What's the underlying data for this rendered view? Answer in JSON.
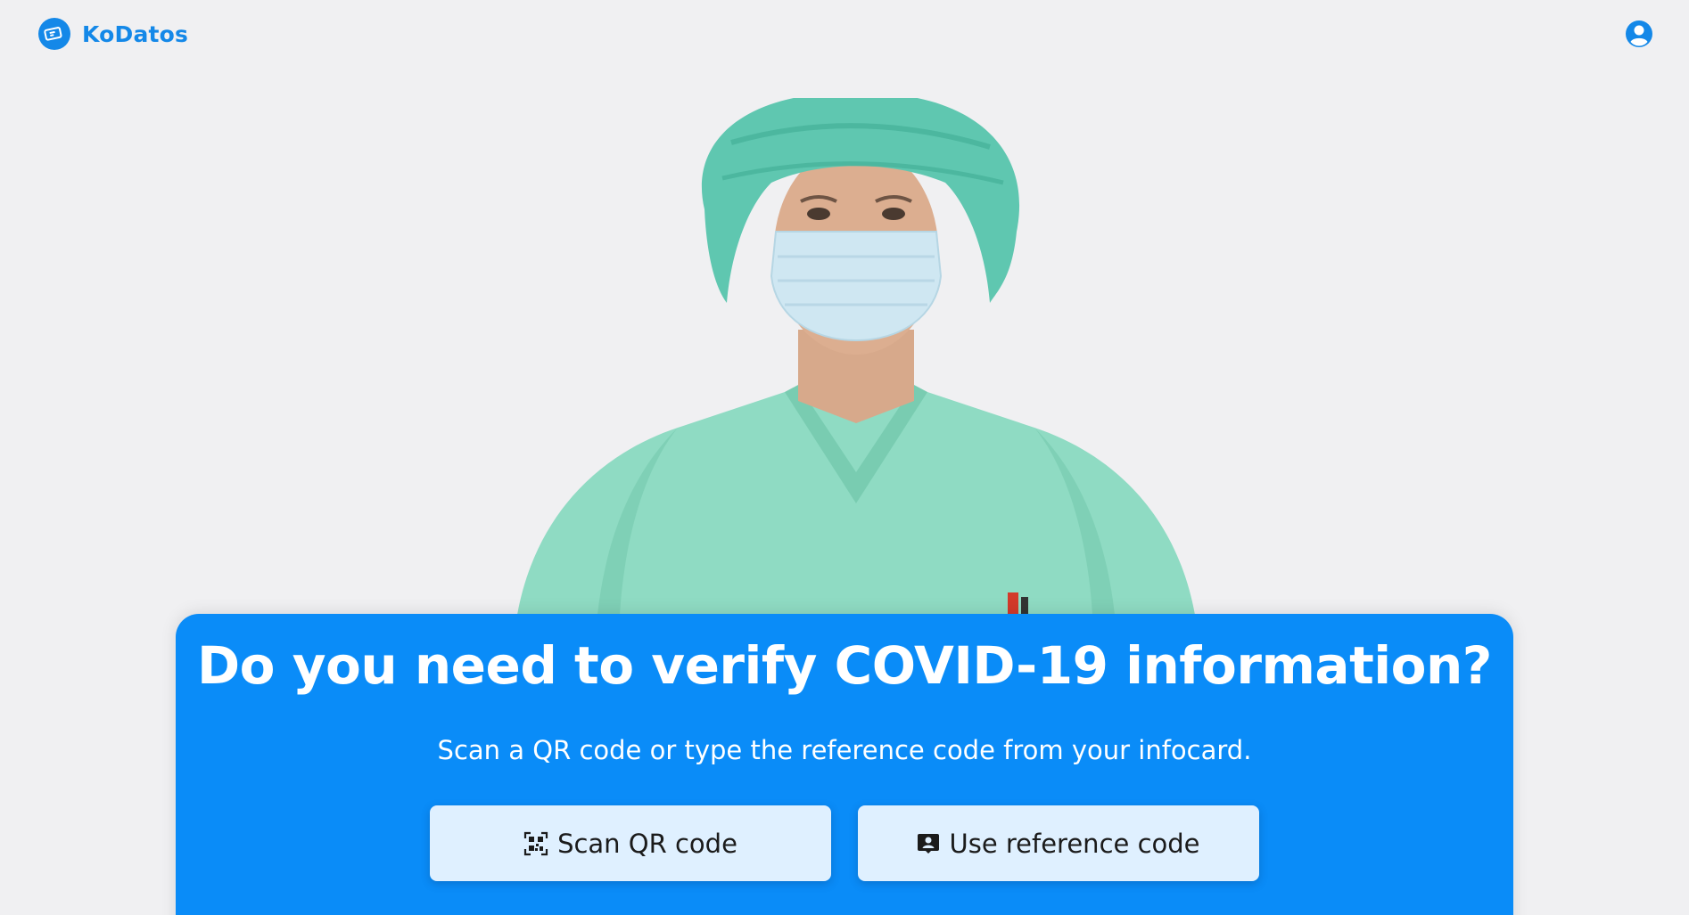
{
  "app": {
    "brand_name": "KoDatos",
    "brand_color": "#1488e8",
    "logo_icon": "ticket-icon",
    "account_icon": "account-circle-icon"
  },
  "hero": {
    "image_description_icon": "healthcare-worker-illustration"
  },
  "panel": {
    "background_color": "#0a8cf8",
    "headline": "Do you need to verify COVID-19 information?",
    "subtitle": "Scan a QR code or type the reference code from your infocard.",
    "buttons": [
      {
        "label": "Scan QR code",
        "icon": "qr-code-icon"
      },
      {
        "label": "Use reference code",
        "icon": "contact-badge-icon"
      }
    ],
    "button_background": "#dff0ff"
  }
}
